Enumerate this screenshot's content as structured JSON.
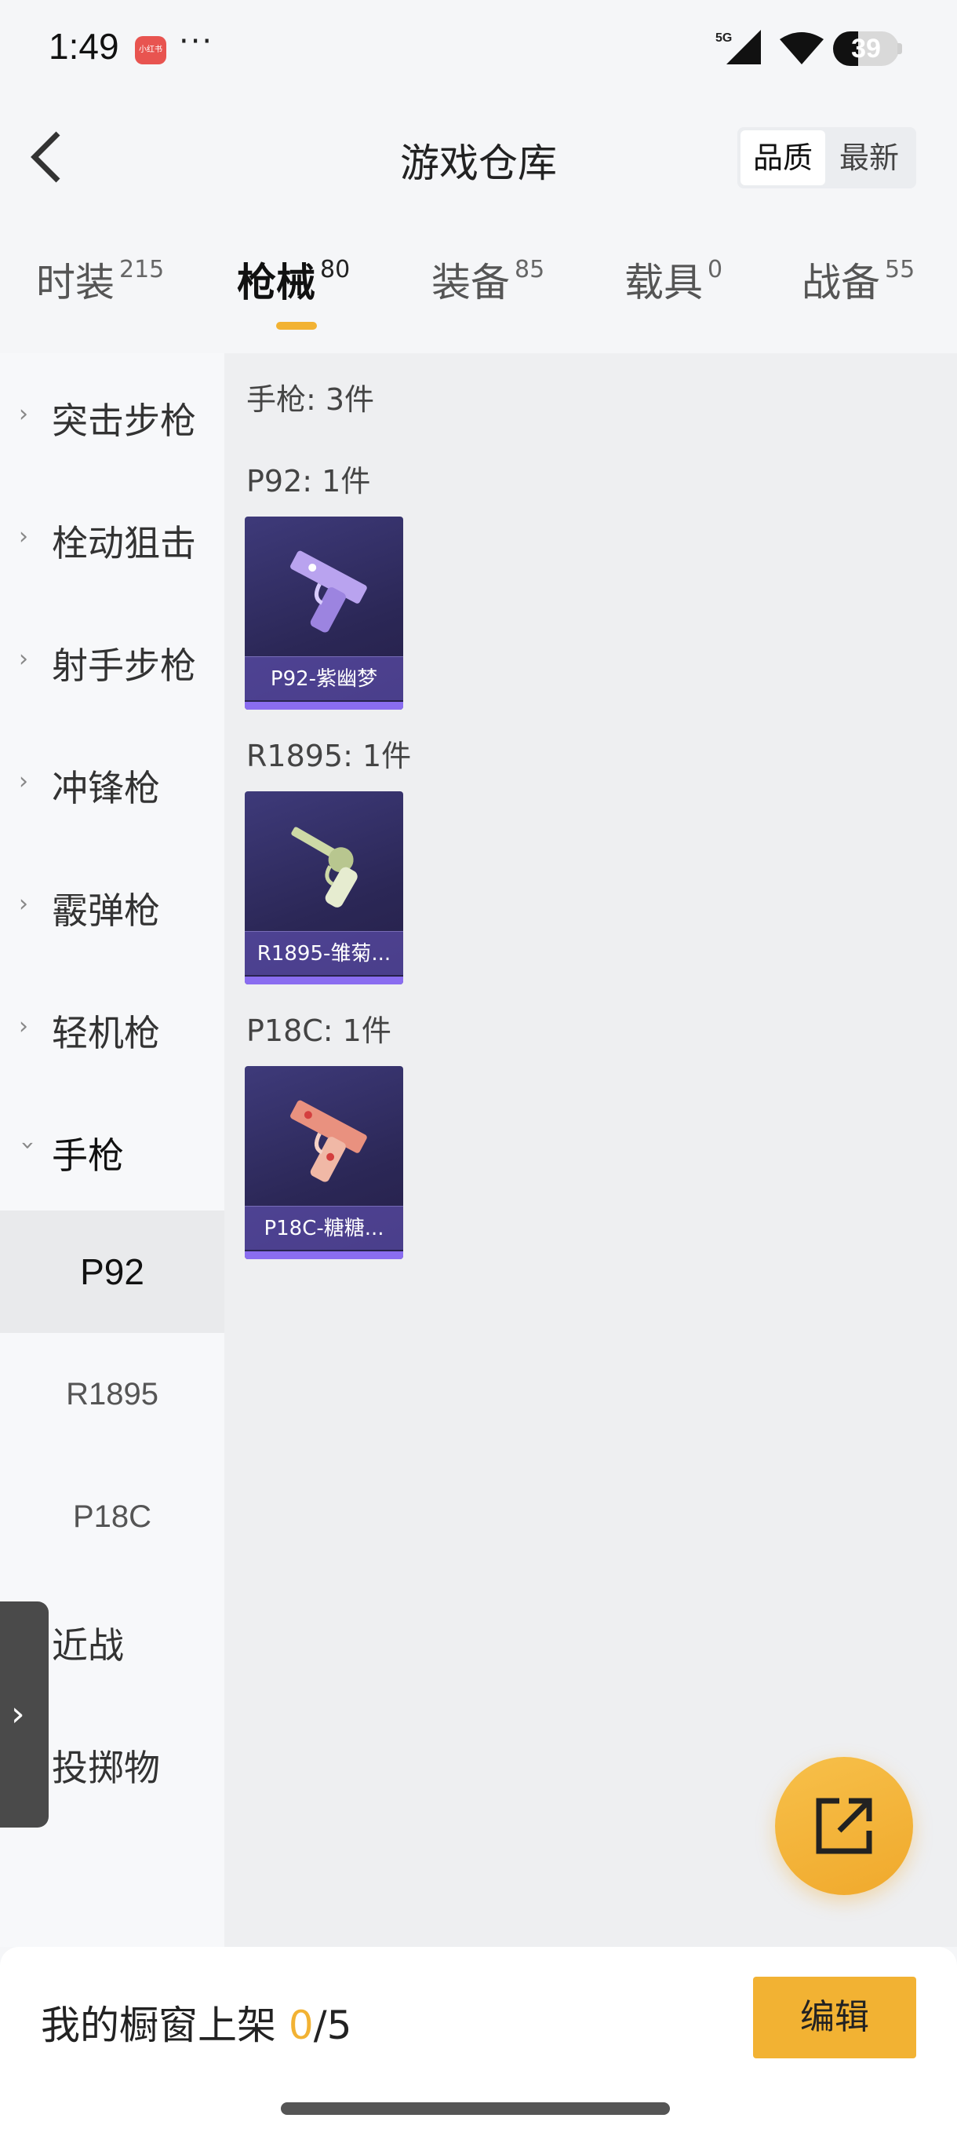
{
  "status_bar": {
    "time": "1:49",
    "app_badge": "小红书",
    "more": "···",
    "network": "5G",
    "battery": "39"
  },
  "header": {
    "title": "游戏仓库",
    "sort_options": [
      "品质",
      "最新"
    ],
    "sort_active": "品质"
  },
  "tabs": [
    {
      "label": "时装",
      "count": "215"
    },
    {
      "label": "枪械",
      "count": "80"
    },
    {
      "label": "装备",
      "count": "85"
    },
    {
      "label": "载具",
      "count": "0"
    },
    {
      "label": "战备",
      "count": "55"
    }
  ],
  "active_tab": "枪械",
  "sidebar": {
    "categories": [
      {
        "label": "突击步枪"
      },
      {
        "label": "栓动狙击"
      },
      {
        "label": "射手步枪"
      },
      {
        "label": "冲锋枪"
      },
      {
        "label": "霰弹枪"
      },
      {
        "label": "轻机枪"
      },
      {
        "label": "手枪"
      }
    ],
    "subcategories": [
      {
        "label": "P92"
      },
      {
        "label": "R1895"
      },
      {
        "label": "P18C"
      }
    ],
    "more_categories": [
      {
        "label": "近战"
      },
      {
        "label": "投掷物"
      }
    ],
    "active_sub": "P92"
  },
  "content": {
    "summary": "手枪: 3件",
    "sections": [
      {
        "heading": "P92: 1件",
        "item": "P92-紫幽梦",
        "gun_color": "#b9a3ef"
      },
      {
        "heading": "R1895: 1件",
        "item": "R1895-雏菊...",
        "gun_color": "#cdd9a6"
      },
      {
        "heading": "P18C: 1件",
        "item": "P18C-糖糖...",
        "gun_color": "#e9917f"
      }
    ]
  },
  "bottom_bar": {
    "shelf_label": "我的橱窗上架",
    "shelf_current": "0",
    "shelf_total": "/5",
    "edit_label": "编辑"
  },
  "colors": {
    "accent": "#f2b233",
    "card_bg": "#2b2756",
    "card_bar": "#8a6df0"
  }
}
